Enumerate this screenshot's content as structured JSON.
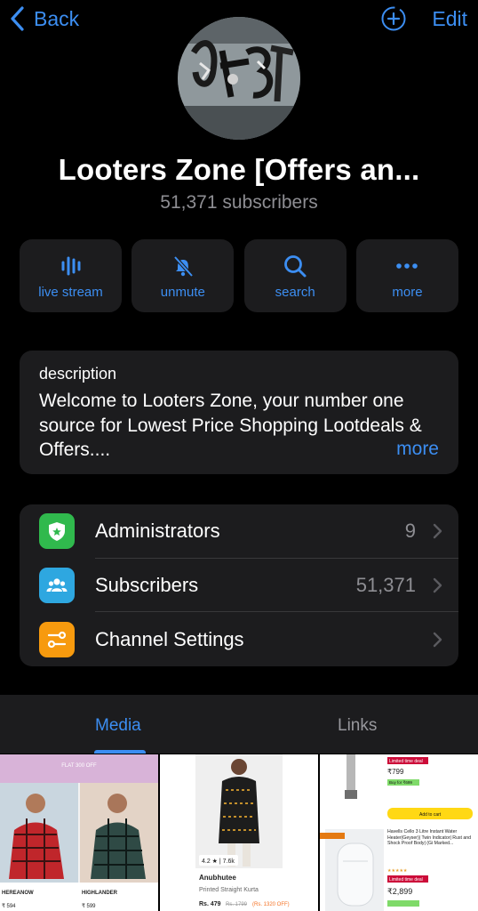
{
  "nav": {
    "back_label": "Back",
    "edit_label": "Edit"
  },
  "channel": {
    "name": "Looters Zone [Offers an...",
    "subscribers": "51,371 subscribers"
  },
  "actions": [
    {
      "label": "live stream",
      "icon": "live-stream-icon"
    },
    {
      "label": "unmute",
      "icon": "bell-slash-icon"
    },
    {
      "label": "search",
      "icon": "search-icon"
    },
    {
      "label": "more",
      "icon": "ellipsis-icon"
    }
  ],
  "description": {
    "label": "description",
    "text": "Welcome to  Looters Zone, your number one source for Lowest Price Shopping Lootdeals & Offers....",
    "more": "more"
  },
  "list": [
    {
      "label": "Administrators",
      "value": "9",
      "icon": "shield-star-icon",
      "color": "#30b94d"
    },
    {
      "label": "Subscribers",
      "value": "51,371",
      "icon": "people-icon",
      "color": "#2ea7e0"
    },
    {
      "label": "Channel Settings",
      "value": "",
      "icon": "sliders-icon",
      "color": "#f79a0e"
    }
  ],
  "tabs": {
    "media": "Media",
    "links": "Links"
  },
  "media": {
    "m1": {
      "banner": "FLAT 300 OFF",
      "brand_left": "HEREANOW",
      "brand_right": "HIGHLANDER",
      "price_left": "₹ 594",
      "price_right": "₹ 599"
    },
    "m2": {
      "rating": "4.2 ★ | 7.6k",
      "brand": "Anubhutee",
      "desc": "Printed Straight Kurta",
      "price": "Rs. 479",
      "mrp": "Rs. 1799",
      "off": "(Rs. 1320 OFF)"
    },
    "m3": {
      "deal": "Limited time deal",
      "price_top": "₹799",
      "deal_tag": "Buy for ₹699",
      "add_cart": "Add to cart",
      "title": "Havells Cello 3 Litre Instant Water Heater(Geyser)| Twin Indicator| Rust and Shock Proof Body| (Gi Marked...",
      "price_bottom": "₹2,899",
      "deal_bottom": "Limited time deal"
    }
  },
  "colors": {
    "accent": "#3c8ef2",
    "card": "#1c1c1e",
    "muted": "#8e8e93"
  }
}
